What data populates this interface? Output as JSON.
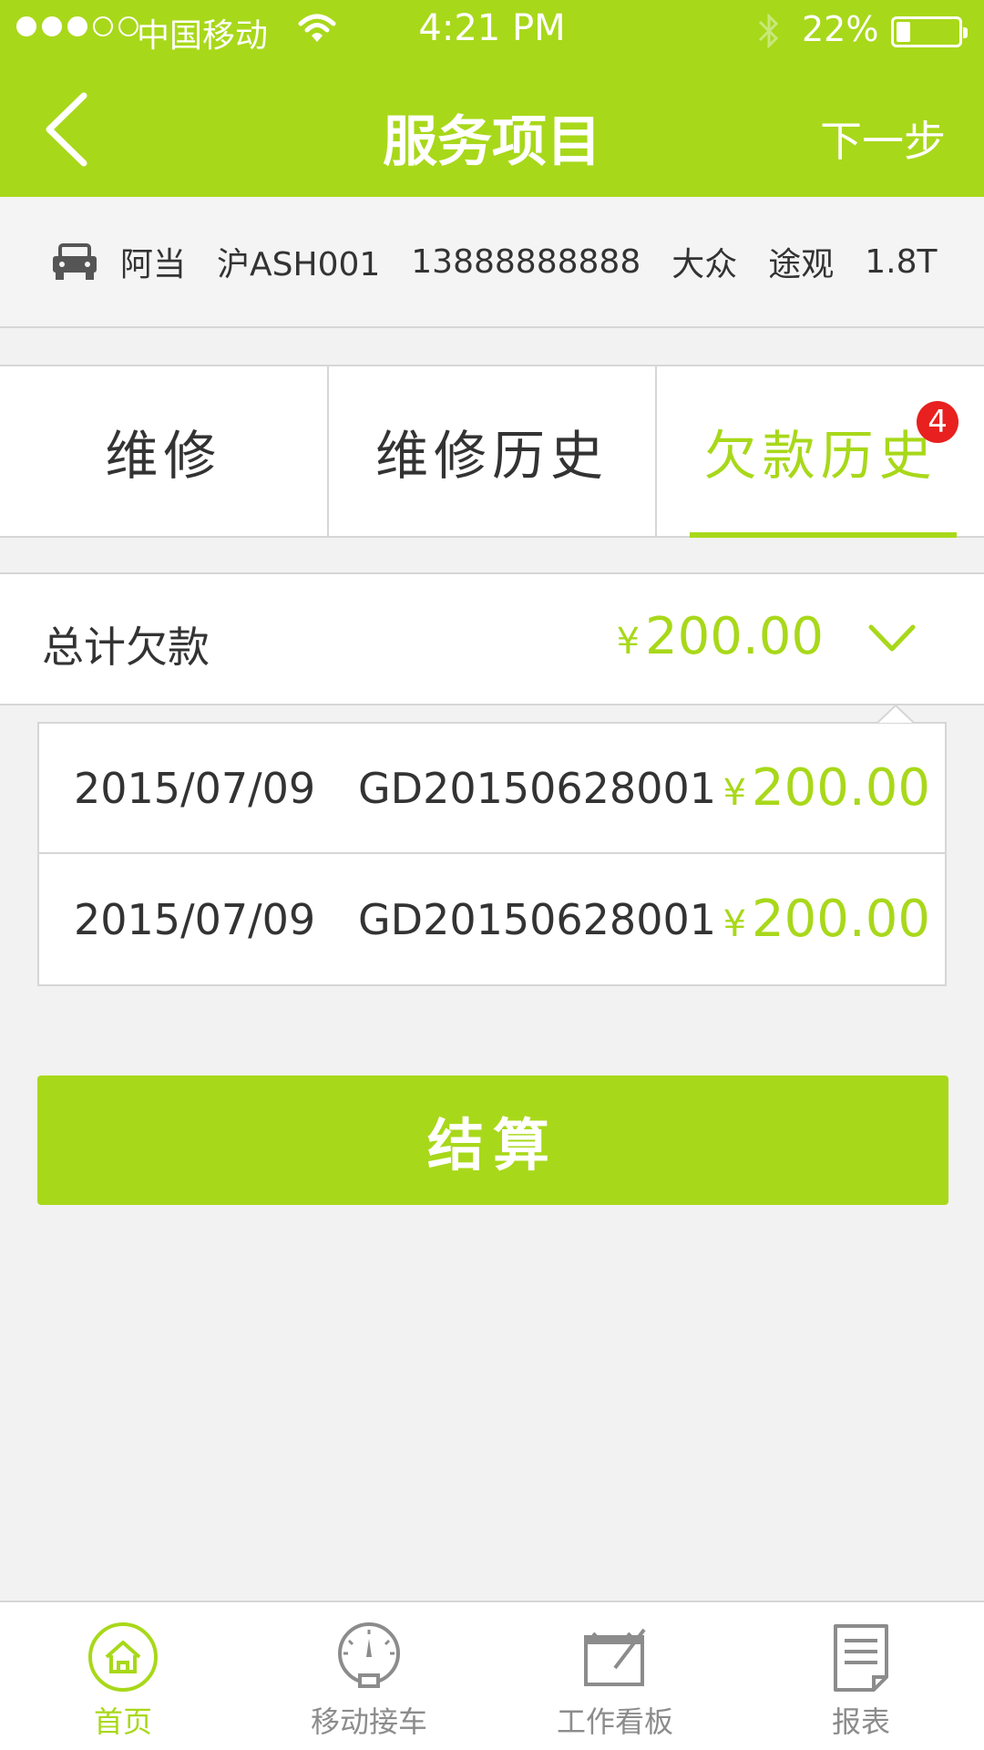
{
  "status_bar": {
    "carrier": "中国移动",
    "time": "4:21 PM",
    "battery_percent_text": "22%",
    "battery_level": 0.22,
    "signal_dots_filled": 3,
    "signal_dots_total": 5
  },
  "nav": {
    "back_icon": "chevron-left-icon",
    "title": "服务项目",
    "next_label": "下一步"
  },
  "customer": {
    "icon": "car-icon",
    "name": "阿当",
    "plate": "沪ASH001",
    "phone": "13888888888",
    "brand": "大众",
    "model": "途观",
    "engine": "1.8T"
  },
  "tabs": [
    {
      "label": "维修"
    },
    {
      "label": "维修历史"
    },
    {
      "label": "欠款历史",
      "badge": "4",
      "active": true
    }
  ],
  "total_debt": {
    "label": "总计欠款",
    "currency": "¥",
    "amount": "200.00",
    "toggle_icon": "chevron-down-icon"
  },
  "debt_records": [
    {
      "date": "2015/07/09",
      "order_no": "GD20150628001",
      "currency": "¥",
      "amount": "200.00"
    },
    {
      "date": "2015/07/09",
      "order_no": "GD20150628001",
      "currency": "¥",
      "amount": "200.00"
    }
  ],
  "settle_button": {
    "label": "结算"
  },
  "tabbar": [
    {
      "label": "首页",
      "icon": "home-icon",
      "active": true
    },
    {
      "label": "移动接车",
      "icon": "gauge-icon"
    },
    {
      "label": "工作看板",
      "icon": "board-icon"
    },
    {
      "label": "报表",
      "icon": "report-icon"
    }
  ],
  "colors": {
    "brand_green": "#a8d81a",
    "badge_red": "#e8201f",
    "background": "#f2f2f2"
  }
}
